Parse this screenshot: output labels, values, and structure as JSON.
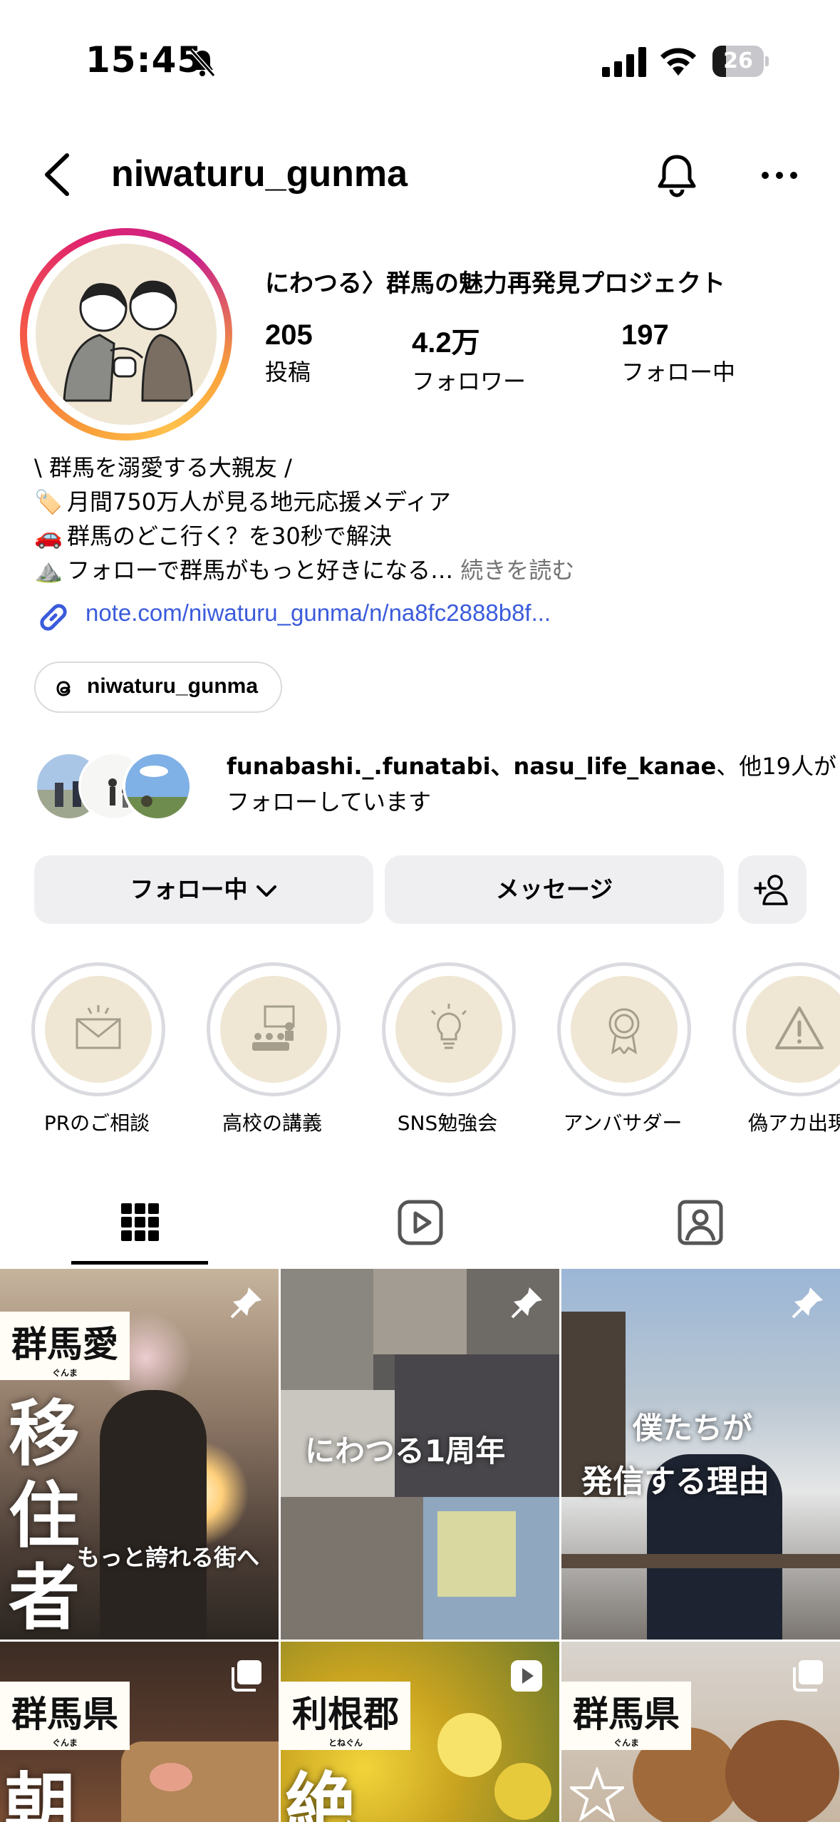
{
  "status_bar": {
    "time": "15:45",
    "battery": "26",
    "battery_level": 0.26
  },
  "header": {
    "username": "niwaturu_gunma"
  },
  "profile": {
    "display_name": "にわつる〉群馬の魅力再発見プロジェクト",
    "stats": [
      {
        "value": "205",
        "label": "投稿"
      },
      {
        "value": "4.2万",
        "label": "フォロワー"
      },
      {
        "value": "197",
        "label": "フォロー中"
      }
    ],
    "bio": {
      "line1": "\\ 群馬を溺愛する大親友 /",
      "line2": "月間750万人が見る地元応援メディア",
      "line3": "群馬のどこ行く？を30秒で解決",
      "line4": "フォローで群馬がもっと好きになる…",
      "more": "続きを読む",
      "emoji2": "🏷️",
      "emoji3": "🚗",
      "emoji4": "⛰️"
    },
    "link": "note.com/niwaturu_gunma/n/na8fc2888b8f...",
    "threads": "niwaturu_gunma",
    "followed_by": {
      "names": "funabashi._.funatabi、nasu_life_kanae",
      "rest": "、他19人がフォローしています"
    }
  },
  "actions": {
    "following": "フォロー中",
    "message": "メッセージ"
  },
  "highlights": [
    {
      "label": "PRのご相談",
      "icon": "envelope-icon"
    },
    {
      "label": "高校の講義",
      "icon": "lecture-icon"
    },
    {
      "label": "SNS勉強会",
      "icon": "lightbulb-icon"
    },
    {
      "label": "アンバサダー",
      "icon": "badge-icon"
    },
    {
      "label": "偽アカ出現",
      "icon": "warning-icon"
    }
  ],
  "tabs": [
    "grid-icon",
    "reels-icon",
    "tagged-icon"
  ],
  "posts": {
    "p1": {
      "tag": "群馬愛",
      "tag_small": "ぐんま",
      "vertical": [
        "移",
        "住",
        "者"
      ],
      "caption": "もっと誇れる街へ"
    },
    "p2": {
      "caption": "にわつる1周年"
    },
    "p3": {
      "line1": "僕たちが",
      "line2": "発信する理由"
    },
    "p4": {
      "tag": "群馬県",
      "tag_small": "ぐんま",
      "char": "朝"
    },
    "p5": {
      "tag": "利根郡",
      "tag_small": "とねぐん",
      "char": "絶"
    },
    "p6": {
      "tag": "群馬県",
      "tag_small": "ぐんま"
    }
  }
}
